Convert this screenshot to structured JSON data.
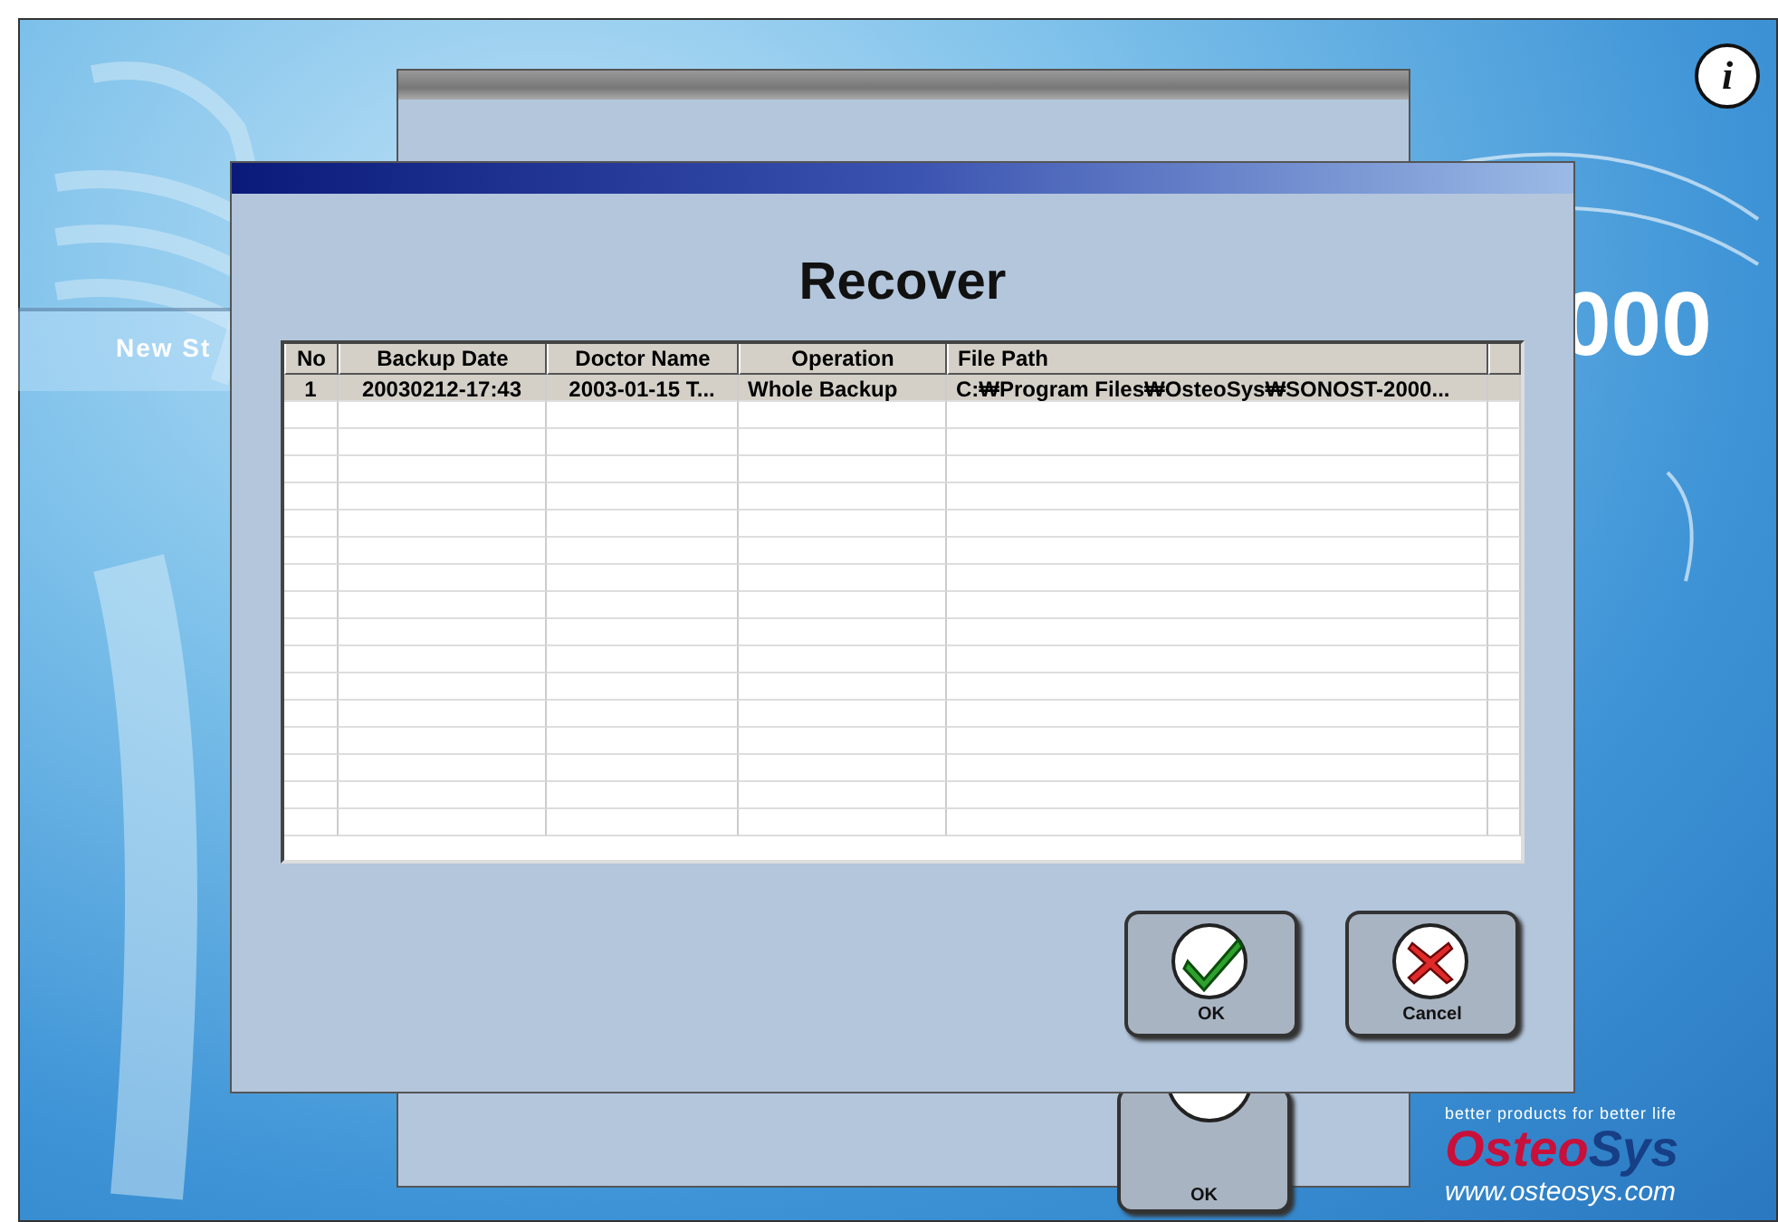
{
  "background": {
    "menu_label": "New St",
    "info_button": "i",
    "title_fragment": "000",
    "logo": {
      "tagline": "better products for better life",
      "name_first": "Osteo",
      "name_second": "Sys",
      "url": "www.osteosys.com"
    }
  },
  "back_dialog": {
    "buttons": [
      {
        "label": "OK",
        "kind": "ok"
      }
    ]
  },
  "dialog": {
    "title": "Recover",
    "table": {
      "columns": [
        "No",
        "Backup Date",
        "Doctor Name",
        "Operation",
        "File Path"
      ],
      "rows": [
        {
          "cells": [
            "1",
            "20030212-17:43",
            "2003-01-15 T...",
            "Whole Backup",
            "C:₩Program Files₩OsteoSys₩SONOST-2000..."
          ],
          "selected": true
        }
      ]
    },
    "buttons": [
      {
        "label": "OK",
        "kind": "ok"
      },
      {
        "label": "Cancel",
        "kind": "cancel"
      }
    ]
  }
}
